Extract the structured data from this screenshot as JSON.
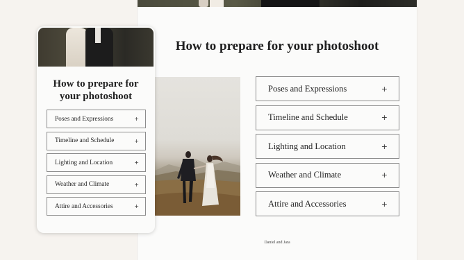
{
  "desktop": {
    "title": "How to prepare for your photoshoot",
    "accordion": [
      {
        "label": "Poses and Expressions",
        "icon": "+"
      },
      {
        "label": "Timeline and Schedule",
        "icon": "+"
      },
      {
        "label": "Lighting and Location",
        "icon": "+"
      },
      {
        "label": "Weather and Climate",
        "icon": "+"
      },
      {
        "label": "Attire and Accessories",
        "icon": "+"
      }
    ],
    "credit": "Daniel and Jara"
  },
  "mobile": {
    "title_line1": "How to prepare for",
    "title_line2": "your photoshoot",
    "accordion": [
      {
        "label": "Poses and Expressions",
        "icon": "+"
      },
      {
        "label": "Timeline and Schedule",
        "icon": "+"
      },
      {
        "label": "Lighting and Location",
        "icon": "+"
      },
      {
        "label": "Weather and Climate",
        "icon": "+"
      },
      {
        "label": "Attire and Accessories",
        "icon": "+"
      }
    ]
  },
  "colors": {
    "background": "#f6f3ef",
    "page": "#fbfbfa",
    "border": "#8c8c8c",
    "text": "#1f1f1f"
  }
}
